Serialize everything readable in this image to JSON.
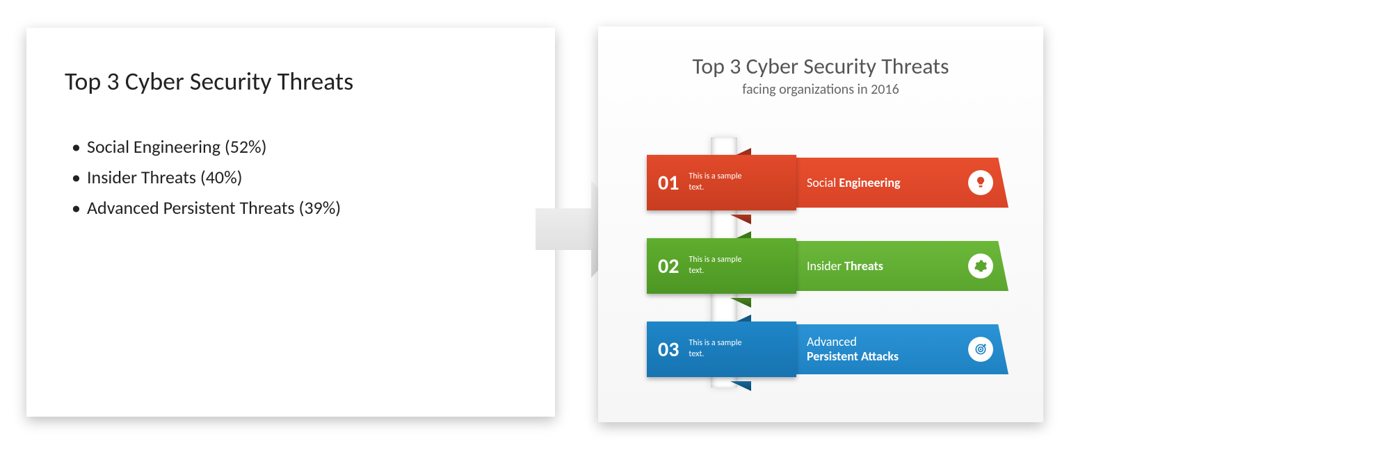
{
  "left": {
    "title": "Top 3 Cyber Security Threats",
    "bullets": [
      "Social Engineering (52%)",
      "Insider Threats (40%)",
      "Advanced Persistent Threats (39%)"
    ]
  },
  "right": {
    "title": "Top 3 Cyber Security Threats",
    "subtitle": "facing organizations in 2016",
    "items": [
      {
        "num": "01",
        "sample": "This is a sample text.",
        "label_thin": "Social ",
        "label_bold": "Engineering",
        "color_tab": "c-red-tab",
        "color_ban": "c-red-ban",
        "icon": "bulb",
        "icon_color": "#d94427"
      },
      {
        "num": "02",
        "sample": "This is a sample text.",
        "label_thin": "Insider ",
        "label_bold": "Threats",
        "color_tab": "c-green-tab",
        "color_ban": "c-green-ban",
        "icon": "gear",
        "icon_color": "#5aa62e"
      },
      {
        "num": "03",
        "sample": "This is a sample text.",
        "label_thin": "Advanced",
        "label_bold": "Persistent Attacks",
        "color_tab": "c-blue-tab",
        "color_ban": "c-blue-ban",
        "icon": "target",
        "icon_color": "#1f82c2"
      }
    ]
  }
}
